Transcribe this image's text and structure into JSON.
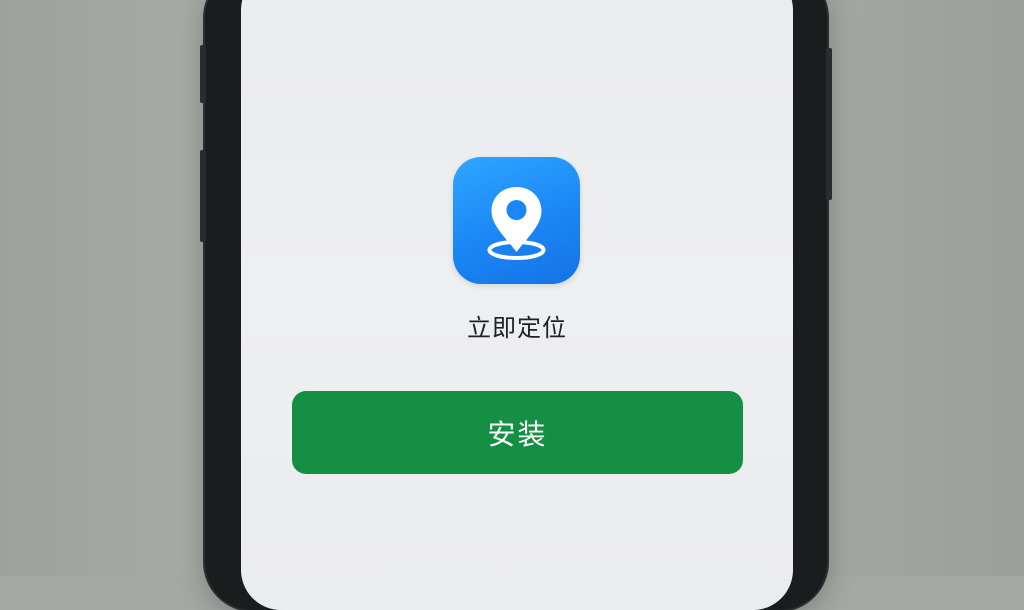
{
  "app": {
    "name": "立即定位",
    "icon": "location-pin-icon",
    "icon_color": "#1b86f5"
  },
  "install_button": {
    "label": "安装",
    "color": "#158f43"
  }
}
